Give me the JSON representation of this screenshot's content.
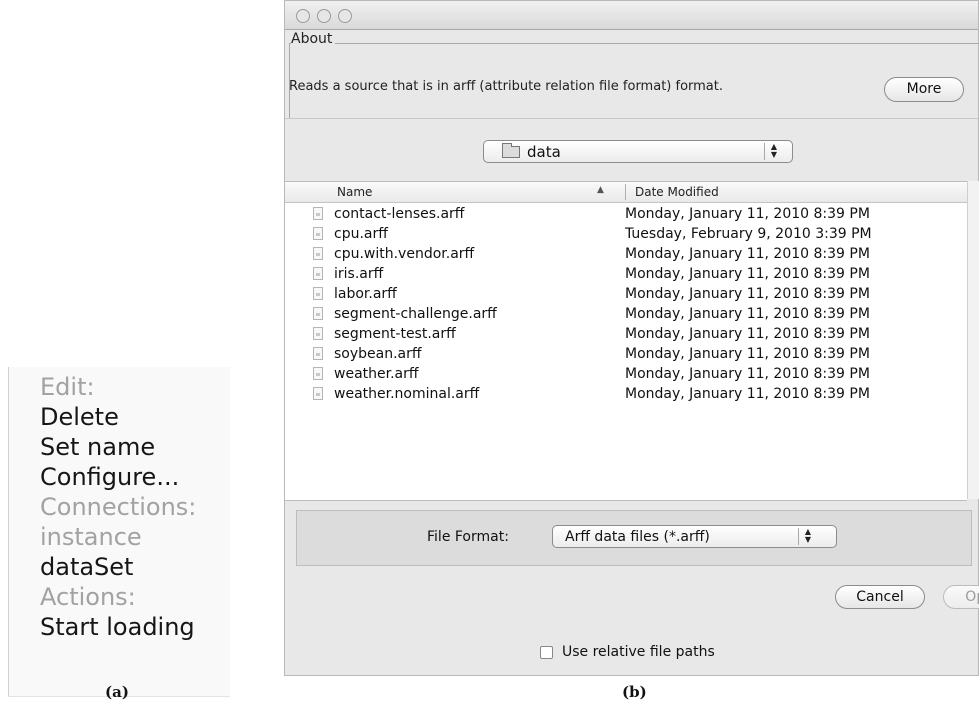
{
  "menu": {
    "items": [
      {
        "label": "Edit:",
        "kind": "header"
      },
      {
        "label": "Delete",
        "kind": "action"
      },
      {
        "label": "Set name",
        "kind": "action"
      },
      {
        "label": "Configure...",
        "kind": "action"
      },
      {
        "label": "Connections:",
        "kind": "header"
      },
      {
        "label": "instance",
        "kind": "header"
      },
      {
        "label": "dataSet",
        "kind": "action"
      },
      {
        "label": "Actions:",
        "kind": "header"
      },
      {
        "label": "Start loading",
        "kind": "action"
      }
    ]
  },
  "captions": {
    "a": "(a)",
    "b": "(b)"
  },
  "dialog": {
    "about": {
      "legend": "About",
      "text": "Reads a source that is in arff (attribute relation file format) format.",
      "more_label": "More"
    },
    "folder": {
      "label": "data",
      "stepper": "▲▼"
    },
    "list": {
      "col_name": "Name",
      "sort_arrow": "▲",
      "col_date": "Date Modified",
      "files": [
        {
          "name": "contact-lenses.arff",
          "date": "Monday, January 11, 2010 8:39 PM"
        },
        {
          "name": "cpu.arff",
          "date": "Tuesday, February 9, 2010 3:39 PM"
        },
        {
          "name": "cpu.with.vendor.arff",
          "date": "Monday, January 11, 2010 8:39 PM"
        },
        {
          "name": "iris.arff",
          "date": "Monday, January 11, 2010 8:39 PM"
        },
        {
          "name": "labor.arff",
          "date": "Monday, January 11, 2010 8:39 PM"
        },
        {
          "name": "segment-challenge.arff",
          "date": "Monday, January 11, 2010 8:39 PM"
        },
        {
          "name": "segment-test.arff",
          "date": "Monday, January 11, 2010 8:39 PM"
        },
        {
          "name": "soybean.arff",
          "date": "Monday, January 11, 2010 8:39 PM"
        },
        {
          "name": "weather.arff",
          "date": "Monday, January 11, 2010 8:39 PM"
        },
        {
          "name": "weather.nominal.arff",
          "date": "Monday, January 11, 2010 8:39 PM"
        }
      ]
    },
    "format": {
      "label": "File Format:",
      "value": "Arff data files (*.arff)",
      "stepper": "▲▼"
    },
    "buttons": {
      "cancel": "Cancel",
      "open": "Open"
    },
    "relative_paths": {
      "label": "Use relative file paths",
      "checked": false
    }
  }
}
